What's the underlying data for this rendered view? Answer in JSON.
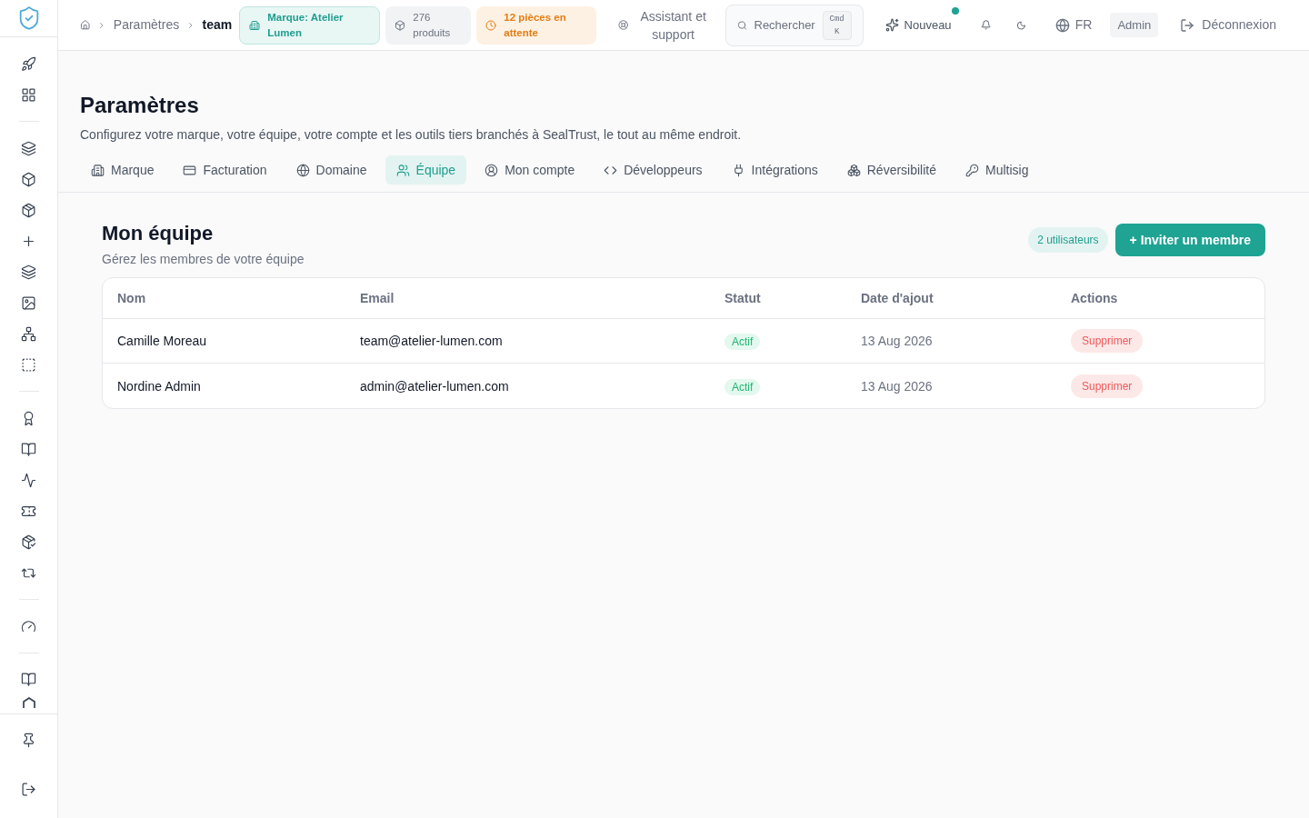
{
  "breadcrumb": [
    "Paramètres",
    "team"
  ],
  "header_chips": [
    {
      "kind": "brand",
      "text": "Marque: Atelier Lumen"
    },
    {
      "kind": "neutral",
      "text": "276 produits"
    },
    {
      "kind": "warning",
      "text": "12 pièces en attente"
    }
  ],
  "support_link": "Assistant et support",
  "search": {
    "placeholder": "Rechercher",
    "shortcut": "Cmd K"
  },
  "new_button": {
    "label": "Nouveau",
    "unread": true
  },
  "language": "FR",
  "role_badge": "Admin",
  "logout": "Déconnexion",
  "page": {
    "title": "Paramètres",
    "subtitle": "Configurez votre marque, votre équipe, votre compte et les outils tiers branchés à SealTrust, le tout au même endroit."
  },
  "tabs": [
    {
      "label": "Marque",
      "selected": false
    },
    {
      "label": "Facturation",
      "selected": false
    },
    {
      "label": "Domaine",
      "selected": false
    },
    {
      "label": "Équipe",
      "selected": true
    },
    {
      "label": "Mon compte",
      "selected": false
    },
    {
      "label": "Développeurs",
      "selected": false
    },
    {
      "label": "Intégrations",
      "selected": false
    },
    {
      "label": "Réversibilité",
      "selected": false
    },
    {
      "label": "Multisig",
      "selected": false
    }
  ],
  "section": {
    "title": "Mon équipe",
    "subtitle": "Gérez les membres de votre équipe",
    "count": "2 utilisateurs",
    "invite_button": "+ Inviter un membre"
  },
  "table": {
    "columns": [
      "Nom",
      "Email",
      "Statut",
      "Date d'ajout",
      "Actions"
    ],
    "rows": [
      {
        "name": "Camille Moreau",
        "email": "team@atelier-lumen.com",
        "status": "Actif",
        "date": "13 Aug 2026",
        "action": "Supprimer"
      },
      {
        "name": "Nordine Admin",
        "email": "admin@atelier-lumen.com",
        "status": "Actif",
        "date": "13 Aug 2026",
        "action": "Supprimer"
      }
    ]
  }
}
